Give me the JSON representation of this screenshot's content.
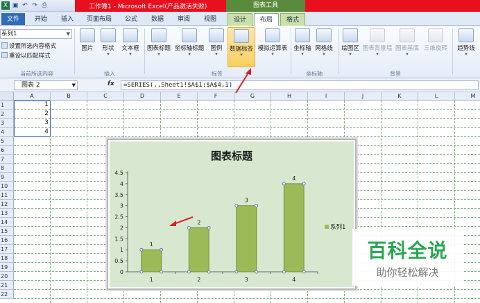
{
  "window": {
    "title": "工作簿1 - Microsoft Excel(产品激活失败)",
    "chart_tools": "图表工具"
  },
  "tabs": [
    "文件",
    "开始",
    "插入",
    "页面布局",
    "公式",
    "数据",
    "审阅",
    "视图",
    "设计",
    "布局",
    "格式"
  ],
  "ribbon": {
    "selection_value": "系列1",
    "format_selection": "设置所选内容格式",
    "reset_style": "重设以匹配样式",
    "group_current": "当前所选内容",
    "insert_buttons": [
      "图片",
      "形状",
      "文本框"
    ],
    "group_insert": "插入",
    "label_buttons": [
      "图表标题",
      "坐标轴标题",
      "图例",
      "数据标签",
      "模拟运算表"
    ],
    "group_labels": "标签",
    "axis_buttons": [
      "坐标轴",
      "网格线"
    ],
    "group_axes": "坐标轴",
    "bg_buttons": [
      "绘图区",
      "图表背景墙",
      "图表基底",
      "三维旋转"
    ],
    "group_bg": "背景",
    "trend_button": "趋势线"
  },
  "formula_bar": {
    "name_box": "图表 2",
    "fx": "fx",
    "formula": "=SERIES(,,Sheet1!$A$1:$A$4,1)"
  },
  "sheet": {
    "columns": [
      "A",
      "B",
      "C",
      "D",
      "E",
      "F",
      "G",
      "H",
      "I",
      "J",
      "K",
      "L",
      "M"
    ],
    "rows": [
      "1",
      "2",
      "3",
      "4",
      "5",
      "6",
      "7",
      "8",
      "9",
      "10",
      "11",
      "12",
      "13",
      "14",
      "15",
      "16",
      "17",
      "18",
      "19",
      "20",
      "21",
      "22"
    ],
    "values": [
      "1",
      "2",
      "3",
      "4"
    ]
  },
  "chart_data": {
    "type": "bar",
    "title": "图表标题",
    "categories": [
      "1",
      "2",
      "3",
      "4"
    ],
    "series": [
      {
        "name": "系列1",
        "values": [
          1,
          2,
          3,
          4
        ]
      }
    ],
    "data_labels": [
      "1",
      "2",
      "3",
      "4"
    ],
    "ylim": [
      0,
      4.5
    ],
    "yticks": [
      "0",
      "0.5",
      "1",
      "1.5",
      "2",
      "2.5",
      "3",
      "3.5",
      "4",
      "4.5"
    ],
    "legend": "right",
    "grid": false,
    "bar_color": "#9bbb59"
  },
  "watermark": {
    "main": "百科全说",
    "sub": "助你轻松解决"
  }
}
